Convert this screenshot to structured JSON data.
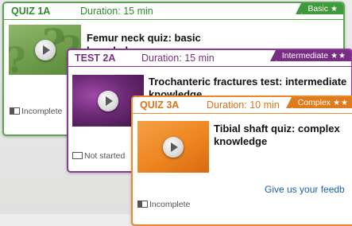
{
  "cards": [
    {
      "code": "QUIZ 1A",
      "duration": "Duration: 15 min",
      "level": "Basic",
      "stars": "★",
      "title": "Femur neck quiz: basic knowledge",
      "status": "Incomplete",
      "colors": {
        "accent": "#3f9a3c",
        "code": "#2d8a2b",
        "thumb": "#7ea85a"
      }
    },
    {
      "code": "TEST 2A",
      "duration": "Duration: 15 min",
      "level": "Intermediate",
      "stars": "★★",
      "title": "Trochanteric fractures test: intermediate knowledge",
      "status": "Not started",
      "colors": {
        "accent": "#7a2d84",
        "code": "#7a2d84",
        "thumb": "#6b2a72"
      }
    },
    {
      "code": "QUIZ 3A",
      "duration": "Duration: 10 min",
      "level": "Complex",
      "stars": "★★",
      "title": "Tibial shaft quiz: complex knowledge",
      "status": "Incomplete",
      "feedback": "Give us your feedb",
      "colors": {
        "accent": "#e07b1c",
        "code": "#d8731a",
        "thumb": "#f08a1e"
      }
    }
  ]
}
